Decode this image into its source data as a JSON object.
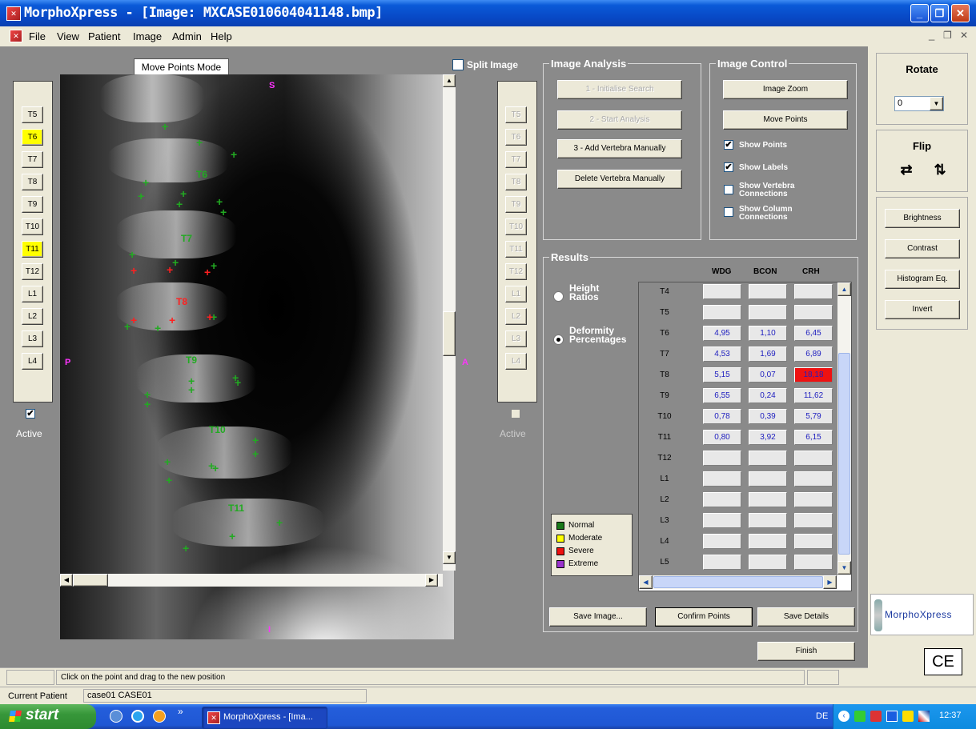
{
  "window": {
    "title": "MorphoXpress - [Image: MXCASE010604041148.bmp]",
    "min_glyph": "_",
    "max_glyph": "❐",
    "close_glyph": "✕",
    "mdi_min": "_",
    "mdi_restore": "❐",
    "mdi_close": "✕"
  },
  "menu": [
    "File",
    "View",
    "Patient",
    "Image",
    "Admin",
    "Help"
  ],
  "mode_label": "Move Points Mode",
  "split_image_label": "Split Image",
  "left_vertebrae": {
    "items": [
      "T5",
      "T6",
      "T7",
      "T8",
      "T9",
      "T10",
      "T11",
      "T12",
      "L1",
      "L2",
      "L3",
      "L4"
    ],
    "highlighted": [
      "T6",
      "T11"
    ],
    "active_checked": true,
    "active_label": "Active"
  },
  "right_vertebrae": {
    "items": [
      "T5",
      "T6",
      "T7",
      "T8",
      "T9",
      "T10",
      "T11",
      "T12",
      "L1",
      "L2",
      "L3",
      "L4"
    ],
    "active_checked": false,
    "active_label": "Active"
  },
  "xray": {
    "orient_top": "S",
    "orient_left": "P",
    "orient_right": "A",
    "orient_bottom": "I",
    "labels": [
      "T6",
      "T7",
      "T8",
      "T9",
      "T10",
      "T11"
    ],
    "label_colors": {
      "normal": "#22aa22",
      "severe": "#ff2020"
    }
  },
  "image_analysis": {
    "title": "Image Analysis",
    "buttons": [
      "1 - Initialise Search",
      "2 - Start Analysis",
      "3 - Add Vertebra Manually",
      "Delete Vertebra Manually"
    ],
    "disabled": [
      true,
      true,
      false,
      false
    ]
  },
  "image_control": {
    "title": "Image Control",
    "buttons": [
      "Image Zoom",
      "Move Points"
    ],
    "checks": [
      {
        "label": "Show Points",
        "checked": true
      },
      {
        "label": "Show Labels",
        "checked": true
      },
      {
        "label": "Show Vertebra Connections",
        "checked": false
      },
      {
        "label": "Show Column Connections",
        "checked": false
      }
    ]
  },
  "results": {
    "title": "Results",
    "options": [
      {
        "label": "Height Ratios",
        "selected": false
      },
      {
        "label": "Deformity Percentages",
        "selected": true
      }
    ],
    "columns": [
      "WDG",
      "BCON",
      "CRH"
    ],
    "rows": [
      {
        "label": "T4",
        "values": [
          "",
          "",
          ""
        ]
      },
      {
        "label": "T5",
        "values": [
          "",
          "",
          ""
        ]
      },
      {
        "label": "T6",
        "values": [
          "4,95",
          "1,10",
          "6,45"
        ]
      },
      {
        "label": "T7",
        "values": [
          "4,53",
          "1,69",
          "6,89"
        ]
      },
      {
        "label": "T8",
        "values": [
          "5,15",
          "0,07",
          "18,18"
        ]
      },
      {
        "label": "T9",
        "values": [
          "6,55",
          "0,24",
          "11,62"
        ]
      },
      {
        "label": "T10",
        "values": [
          "0,78",
          "0,39",
          "5,79"
        ]
      },
      {
        "label": "T11",
        "values": [
          "0,80",
          "3,92",
          "6,15"
        ]
      },
      {
        "label": "T12",
        "values": [
          "",
          "",
          ""
        ]
      },
      {
        "label": "L1",
        "values": [
          "",
          "",
          ""
        ]
      },
      {
        "label": "L2",
        "values": [
          "",
          "",
          ""
        ]
      },
      {
        "label": "L3",
        "values": [
          "",
          "",
          ""
        ]
      },
      {
        "label": "L4",
        "values": [
          "",
          "",
          ""
        ]
      },
      {
        "label": "L5",
        "values": [
          "",
          "",
          ""
        ]
      }
    ],
    "severe_cell": {
      "row": "T8",
      "column": "CRH",
      "color": "#ee1111"
    }
  },
  "legend": [
    {
      "label": "Normal",
      "color": "#1a7a1a"
    },
    {
      "label": "Moderate",
      "color": "#ffff00"
    },
    {
      "label": "Severe",
      "color": "#ee1111"
    },
    {
      "label": "Extreme",
      "color": "#9933cc"
    }
  ],
  "bottom_buttons": [
    "Save Image...",
    "Confirm Points",
    "Save Details"
  ],
  "finish_label": "Finish",
  "right_panel": {
    "rotate_title": "Rotate",
    "rotate_value": "0",
    "flip_title": "Flip",
    "buttons": [
      "Brightness",
      "Contrast",
      "Histogram Eq.",
      "Invert"
    ],
    "logo_text": "MorphoXpress",
    "ce_mark": "CE"
  },
  "status": {
    "message": "Click on the point and drag to the new position",
    "current_patient_label": "Current Patient",
    "current_patient_value": "case01 CASE01"
  },
  "taskbar": {
    "start_label": "start",
    "task_label": "MorphoXpress - [Ima...",
    "lang": "DE",
    "clock": "12:37",
    "chevron": "»"
  }
}
